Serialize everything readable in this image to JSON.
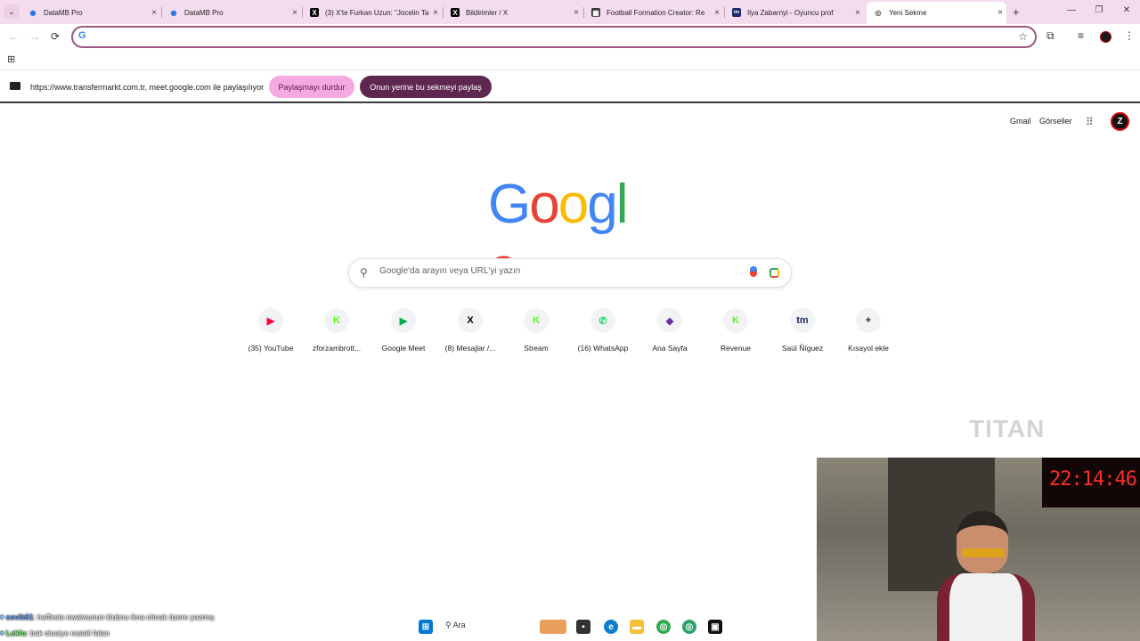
{
  "tabs": [
    {
      "title": "DataMB Pro",
      "favicon": "globe-icon",
      "close": "×"
    },
    {
      "title": "DataMB Pro",
      "favicon": "globe-icon",
      "close": "×"
    },
    {
      "title": "(3) X'te Furkan Uzun: \"Jocelin Ta",
      "favicon": "x-icon",
      "close": "×"
    },
    {
      "title": "Bildirimler / X",
      "favicon": "x-icon",
      "close": "×"
    },
    {
      "title": "Football Formation Creator: Re",
      "favicon": "pitch-icon",
      "close": "×"
    },
    {
      "title": "Ilya Zabarnyi - Oyuncu prof",
      "favicon": "transfermarkt-icon",
      "close": "×"
    },
    {
      "title": "Yeni Sekme",
      "favicon": "chrome-icon",
      "close": "×",
      "active": true
    }
  ],
  "toolbar": {
    "back": "←",
    "forward": "→",
    "reload": "⟳",
    "omnibox_value": "",
    "omnibox_g": "G",
    "star": "☆",
    "extensions": "⧉",
    "media": "≡"
  },
  "window": {
    "minimize": "—",
    "maximize": "❐",
    "close": "✕",
    "newtab": "+",
    "tablist": "⌄"
  },
  "sharebar": {
    "text": "https://www.transfermarkt.com.tr, meet.google.com ile paylaşılıyor",
    "stop_label": "Paylaşmayı durdur",
    "share_label": "Onun yerine bu sekmeyi paylaş"
  },
  "topnav": {
    "gmail": "Gmail",
    "images": "Görseller",
    "avatar": "Z"
  },
  "logo": [
    "G",
    "o",
    "o",
    "g",
    "l",
    "e"
  ],
  "logo_colors": [
    "#4285f4",
    "#ea4335",
    "#fbbc05",
    "#4285f4",
    "#34a853",
    "#ea4335"
  ],
  "search": {
    "placeholder": "Google'da arayın veya URL'yi yazın"
  },
  "shortcuts": [
    {
      "label": "(35) YouTube",
      "glyph": "▶",
      "color": "#ff0033",
      "icon": "youtube-icon"
    },
    {
      "label": "zforzambrott...",
      "glyph": "K",
      "color": "#53fc18",
      "icon": "kick-icon"
    },
    {
      "label": "Google Meet",
      "glyph": "▶",
      "color": "#00ac47",
      "icon": "meet-icon"
    },
    {
      "label": "(8) Mesajlar /...",
      "glyph": "X",
      "color": "#000000",
      "icon": "x-icon"
    },
    {
      "label": "Stream",
      "glyph": "K",
      "color": "#53fc18",
      "icon": "kick-icon"
    },
    {
      "label": "(16) WhatsApp",
      "glyph": "✆",
      "color": "#25d366",
      "icon": "whatsapp-icon"
    },
    {
      "label": "Ana Sayfa",
      "glyph": "◆",
      "color": "#6b2fa0",
      "icon": "home-icon"
    },
    {
      "label": "Revenue",
      "glyph": "K",
      "color": "#53fc18",
      "icon": "kick-icon"
    },
    {
      "label": "Saúl Ñíguez",
      "glyph": "tm",
      "color": "#1a2b6b",
      "icon": "transfermarkt-icon"
    },
    {
      "label": "Kısayol ekle",
      "glyph": "+",
      "color": "#202124",
      "icon": "plus-icon"
    }
  ],
  "overlay": {
    "watermark": "TITAN",
    "clock": "22:14:46",
    "chat": [
      {
        "user": "cevik61",
        "message": ": heffirets nwaiwunun klubnu ikna olmak üzere yazmış"
      },
      {
        "user": "Lekfu",
        "message": ": bak oluaiye rastali falan"
      }
    ]
  },
  "taskbar": {
    "search_label": "Ara"
  }
}
